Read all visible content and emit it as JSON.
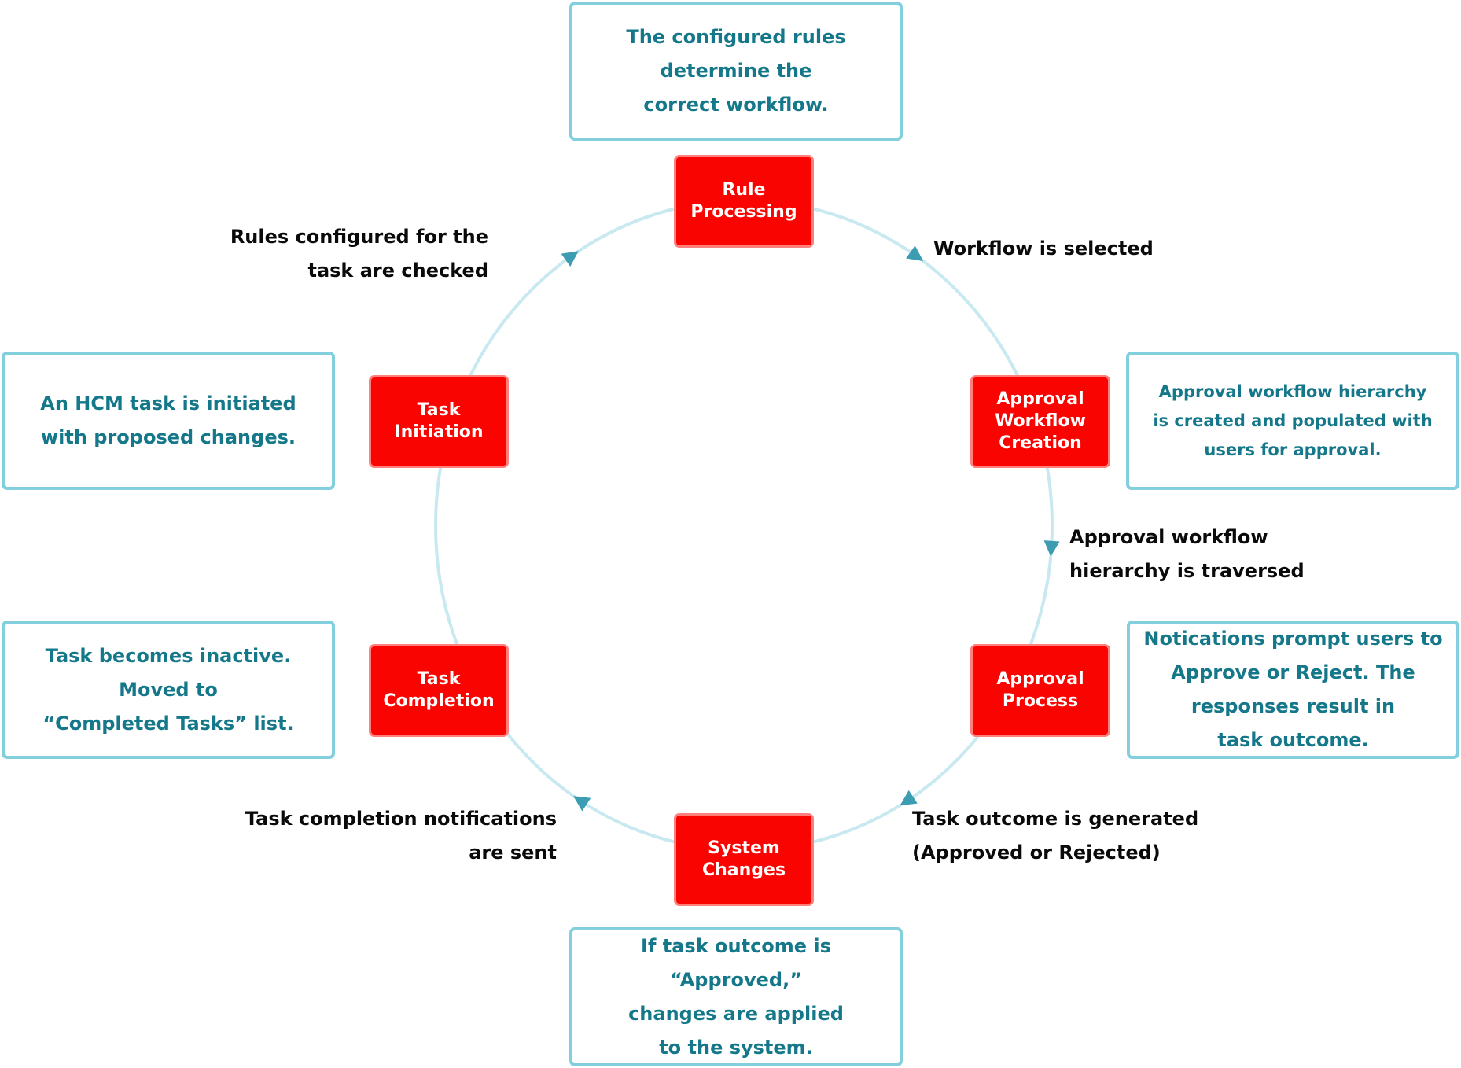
{
  "colors": {
    "stage_fill": "#f90400",
    "stage_border": "#ff7f7d",
    "desc_border": "#84cfdd",
    "desc_text": "#15788a",
    "ring": "#c9e9f0",
    "arrow": "#3b9cb2",
    "step_text": "#0a0a0a"
  },
  "stages": [
    {
      "id": "rule-processing",
      "lines": [
        "Rule",
        "Processing"
      ]
    },
    {
      "id": "approval-workflow-creation",
      "lines": [
        "Approval",
        "Workflow",
        "Creation"
      ]
    },
    {
      "id": "approval-process",
      "lines": [
        "Approval",
        "Process"
      ]
    },
    {
      "id": "system-changes",
      "lines": [
        "System",
        "Changes"
      ]
    },
    {
      "id": "task-completion",
      "lines": [
        "Task",
        "Completion"
      ]
    },
    {
      "id": "task-initiation",
      "lines": [
        "Task",
        "Initiation"
      ]
    }
  ],
  "descriptions": [
    {
      "id": "rule-processing",
      "lines": [
        "The configured rules",
        "determine the",
        "correct workflow."
      ]
    },
    {
      "id": "approval-workflow-creation",
      "lines": [
        "Approval workflow hierarchy",
        "is created and populated with",
        "users for approval."
      ]
    },
    {
      "id": "approval-process",
      "lines": [
        "Notications prompt users to",
        "Approve or Reject. The",
        "responses result in",
        "task outcome."
      ]
    },
    {
      "id": "system-changes",
      "lines": [
        "If task outcome is “Approved,”",
        "changes are applied",
        "to the system."
      ]
    },
    {
      "id": "task-completion",
      "lines": [
        "Task becomes inactive.",
        "Moved to",
        "“Completed Tasks” list."
      ]
    },
    {
      "id": "task-initiation",
      "lines": [
        "An HCM task is initiated",
        "with proposed changes."
      ]
    }
  ],
  "transitions": [
    {
      "id": "rules-checked",
      "lines": [
        "Rules configured for the",
        "task are checked"
      ]
    },
    {
      "id": "workflow-selected",
      "lines": [
        "Workflow is selected"
      ]
    },
    {
      "id": "hierarchy-traversed",
      "lines": [
        "Approval workflow",
        "hierarchy is traversed"
      ]
    },
    {
      "id": "outcome-generated",
      "lines": [
        "Task outcome is generated",
        "(Approved or Rejected)"
      ]
    },
    {
      "id": "completion-notifications",
      "lines": [
        "Task completion notifications",
        "are sent"
      ]
    }
  ]
}
